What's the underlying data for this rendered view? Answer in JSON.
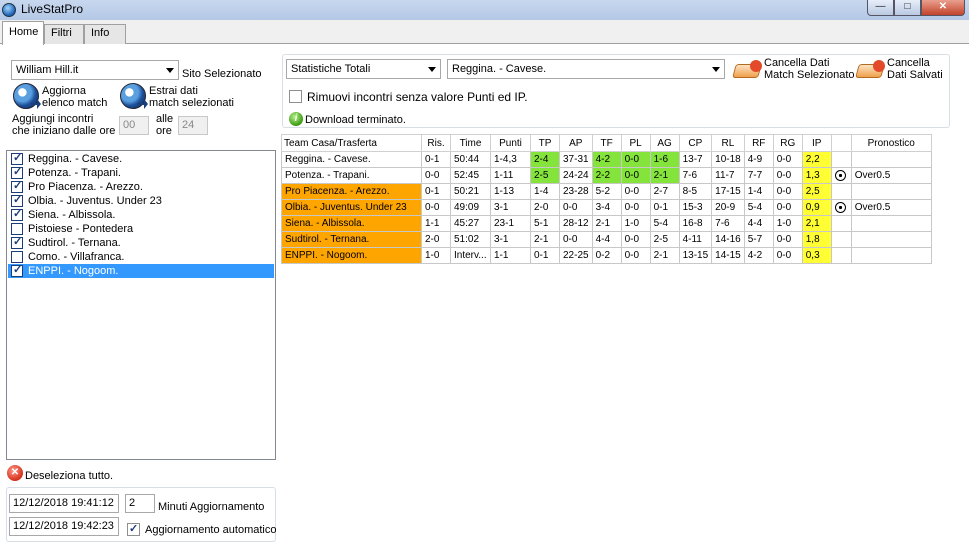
{
  "window": {
    "title": "LiveStatPro"
  },
  "tabs": [
    {
      "label": "Home",
      "active": true
    },
    {
      "label": "Filtri",
      "active": false
    },
    {
      "label": "Info",
      "active": false
    }
  ],
  "left": {
    "site_combo": "William Hill.it",
    "site_label": "Sito Selezionato",
    "update_list_label": "Aggiorna\nelenco match",
    "extract_label": "Estrai dati\nmatch selezionati",
    "add_matches_label": "Aggiungi incontri\nche iniziano dalle ore",
    "from_hour": "00",
    "alle_label": "alle\nore",
    "to_hour": "24",
    "matches": [
      {
        "name": "Reggina.  - Cavese.",
        "checked": true,
        "selected": false
      },
      {
        "name": "Potenza.  - Trapani.",
        "checked": true,
        "selected": false
      },
      {
        "name": "Pro Piacenza.  - Arezzo.",
        "checked": true,
        "selected": false
      },
      {
        "name": "Olbia.  - Juventus. Under 23",
        "checked": true,
        "selected": false
      },
      {
        "name": "Siena.  - Albissola.",
        "checked": true,
        "selected": false
      },
      {
        "name": "Pistoiese  - Pontedera",
        "checked": false,
        "selected": false
      },
      {
        "name": "Sudtirol.  - Ternana.",
        "checked": true,
        "selected": false
      },
      {
        "name": "Como.  - Villafranca.",
        "checked": false,
        "selected": false
      },
      {
        "name": "ENPPI.  - Nogoom.",
        "checked": true,
        "selected": true
      }
    ],
    "deselect_label": "Deseleziona tutto.",
    "datetime_1": "12/12/2018 19:41:12",
    "datetime_2": "12/12/2018 19:42:23",
    "minutes_value": "2",
    "minutes_label": "Minuti Aggiornamento",
    "auto_update_label": "Aggiornamento automatico",
    "auto_update_checked": true
  },
  "top": {
    "stats_combo": "Statistiche Totali",
    "match_combo": "Reggina. - Cavese.",
    "clear_selected_label": "Cancella Dati\nMatch Selezionato",
    "clear_saved_label": "Cancella\nDati Salvati",
    "remove_label": "Rimuovi incontri senza valore Punti ed IP.",
    "remove_checked": false,
    "status": "Download terminato."
  },
  "table": {
    "columns": [
      "Team Casa/Trasferta",
      "Ris.",
      "Time",
      "Punti",
      "TP",
      "AP",
      "TF",
      "PL",
      "AG",
      "CP",
      "RL",
      "RF",
      "RG",
      "IP",
      "",
      "Pronostico"
    ],
    "rows": [
      {
        "cells": [
          "Reggina. - Cavese.",
          "0-1",
          "50:44",
          "1-4,3",
          "2-4",
          "37-31",
          "4-2",
          "0-0",
          "1-6",
          "13-7",
          "10-18",
          "4-9",
          "0-0",
          "2,2",
          "",
          ""
        ],
        "team_orange": false,
        "green_cols": [
          4,
          6,
          7,
          8
        ],
        "ball": false
      },
      {
        "cells": [
          "Potenza. - Trapani.",
          "0-0",
          "52:45",
          "1-11",
          "2-5",
          "24-24",
          "2-2",
          "0-0",
          "2-1",
          "7-6",
          "11-7",
          "7-7",
          "0-0",
          "1,3",
          "",
          "Over0.5"
        ],
        "team_orange": false,
        "green_cols": [
          4,
          6,
          7,
          8
        ],
        "ball": true
      },
      {
        "cells": [
          "Pro Piacenza. - Arezzo.",
          "0-1",
          "50:21",
          "1-13",
          "1-4",
          "23-28",
          "5-2",
          "0-0",
          "2-7",
          "8-5",
          "17-15",
          "1-4",
          "0-0",
          "2,5",
          "",
          ""
        ],
        "team_orange": true,
        "green_cols": [],
        "ball": false
      },
      {
        "cells": [
          "Olbia. - Juventus. Under 23",
          "0-0",
          "49:09",
          "3-1",
          "2-0",
          "0-0",
          "3-4",
          "0-0",
          "0-1",
          "15-3",
          "20-9",
          "5-4",
          "0-0",
          "0,9",
          "",
          "Over0.5"
        ],
        "team_orange": true,
        "green_cols": [],
        "ball": true
      },
      {
        "cells": [
          "Siena. - Albissola.",
          "1-1",
          "45:27",
          "23-1",
          "5-1",
          "28-12",
          "2-1",
          "1-0",
          "5-4",
          "16-8",
          "7-6",
          "4-4",
          "1-0",
          "2,1",
          "",
          ""
        ],
        "team_orange": true,
        "green_cols": [],
        "ball": false
      },
      {
        "cells": [
          "Sudtirol. - Ternana.",
          "2-0",
          "51:02",
          "3-1",
          "2-1",
          "0-0",
          "4-4",
          "0-0",
          "2-5",
          "4-11",
          "14-16",
          "5-7",
          "0-0",
          "1,8",
          "",
          ""
        ],
        "team_orange": true,
        "green_cols": [],
        "ball": false
      },
      {
        "cells": [
          "ENPPI. - Nogoom.",
          "1-0",
          "Interv...",
          "1-1",
          "0-1",
          "22-25",
          "0-2",
          "0-0",
          "2-1",
          "13-15",
          "14-15",
          "4-2",
          "0-0",
          "0,3",
          "",
          ""
        ],
        "team_orange": true,
        "green_cols": [],
        "ball": false
      }
    ]
  },
  "icons": {
    "app": "livestat-icon",
    "update": "soccer-ball-refresh-icon",
    "extract": "soccer-ball-extract-icon",
    "eraser": "eraser-icon",
    "deselect": "red-x-icon",
    "info": "info-icon",
    "ball": "soccer-ball-icon"
  },
  "colors": {
    "orange": "#ffa500",
    "green": "#84e43c",
    "yellow": "#ffff33",
    "selection": "#3399ff"
  }
}
